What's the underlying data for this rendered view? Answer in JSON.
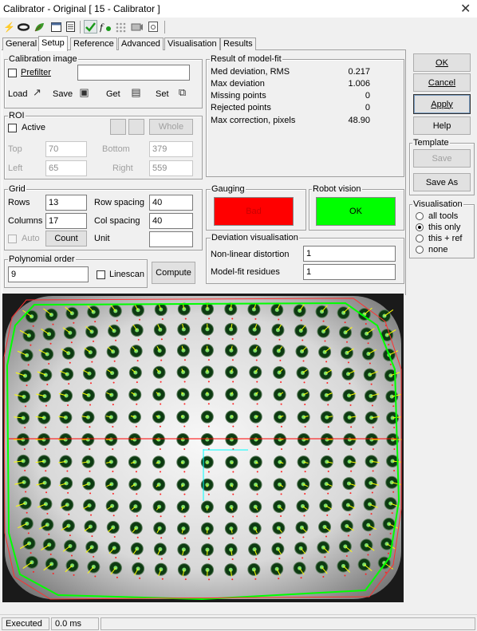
{
  "window": {
    "title": "Calibrator - Original [ 15 - Calibrator ]",
    "close_glyph": "✕"
  },
  "toolbar": {
    "icons": [
      "lightning-icon",
      "link-icon",
      "leaf-icon",
      "window-icon",
      "document-icon",
      "checkmark-icon",
      "function-icon",
      "grid-icon",
      "camera-icon",
      "sheet-icon"
    ]
  },
  "tabs": [
    "General",
    "Setup",
    "Reference",
    "Advanced",
    "Visualisation",
    "Results"
  ],
  "active_tab": "Setup",
  "calibration_image": {
    "legend": "Calibration image",
    "prefilter_label": "Prefilter",
    "path_value": "",
    "load_label": "Load",
    "save_label": "Save",
    "get_label": "Get",
    "set_label": "Set"
  },
  "roi": {
    "legend": "ROI",
    "active_label": "Active",
    "whole_label": "Whole",
    "top_label": "Top",
    "top_value": "70",
    "bottom_label": "Bottom",
    "bottom_value": "379",
    "left_label": "Left",
    "left_value": "65",
    "right_label": "Right",
    "right_value": "559"
  },
  "grid": {
    "legend": "Grid",
    "rows_label": "Rows",
    "rows_value": "13",
    "row_spacing_label": "Row spacing",
    "row_spacing_value": "40",
    "columns_label": "Columns",
    "columns_value": "17",
    "col_spacing_label": "Col spacing",
    "col_spacing_value": "40",
    "auto_label": "Auto",
    "count_label": "Count",
    "unit_label": "Unit",
    "unit_value": ""
  },
  "polynomial": {
    "legend": "Polynomial order",
    "value": "9",
    "linescan_label": "Linescan",
    "compute_label": "Compute"
  },
  "result": {
    "legend": "Result of model-fit",
    "rows": [
      {
        "name": "Med deviation, RMS",
        "value": "0.217"
      },
      {
        "name": "Max deviation",
        "value": "1.006"
      },
      {
        "name": "Missing points",
        "value": "0"
      },
      {
        "name": "Rejected points",
        "value": "0"
      },
      {
        "name": "Max correction, pixels",
        "value": "48.90"
      }
    ]
  },
  "gauging": {
    "legend": "Gauging",
    "status": "Bad",
    "color": "#ff0000"
  },
  "robot_vision": {
    "legend": "Robot vision",
    "status": "OK",
    "color": "#00ff00"
  },
  "deviation": {
    "legend": "Deviation visualisation",
    "nonlinear_label": "Non-linear distortion",
    "nonlinear_value": "1",
    "residues_label": "Model-fit residues",
    "residues_value": "1"
  },
  "side": {
    "ok_label": "OK",
    "cancel_label": "Cancel",
    "apply_label": "Apply",
    "help_label": "Help",
    "template_legend": "Template",
    "template_save_label": "Save",
    "save_as_label": "Save As",
    "visualisation_legend": "Visualisation",
    "vis_options": [
      "all tools",
      "this only",
      "this + ref",
      "none"
    ],
    "vis_selected": "this only"
  },
  "status": {
    "state": "Executed",
    "time": "0.0 ms"
  },
  "colors": {
    "grid_line": "#00ff00",
    "vector": "#ffff00",
    "axis_h": "#ff0000",
    "axis_v": "#00ffff"
  }
}
